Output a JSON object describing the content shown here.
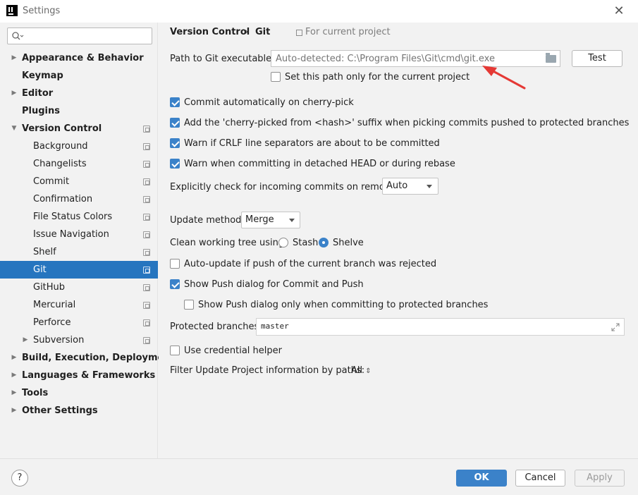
{
  "window": {
    "title": "Settings"
  },
  "search": {
    "placeholder": "",
    "value": ""
  },
  "sidebar": {
    "items": [
      {
        "label": "Appearance & Behavior",
        "bold": true,
        "expandable": true,
        "expanded": false
      },
      {
        "label": "Keymap",
        "bold": true
      },
      {
        "label": "Editor",
        "bold": true,
        "expandable": true,
        "expanded": false
      },
      {
        "label": "Plugins",
        "bold": true
      },
      {
        "label": "Version Control",
        "bold": true,
        "expandable": true,
        "expanded": true
      },
      {
        "label": "Background"
      },
      {
        "label": "Changelists"
      },
      {
        "label": "Commit"
      },
      {
        "label": "Confirmation"
      },
      {
        "label": "File Status Colors"
      },
      {
        "label": "Issue Navigation"
      },
      {
        "label": "Shelf"
      },
      {
        "label": "Git",
        "selected": true
      },
      {
        "label": "GitHub"
      },
      {
        "label": "Mercurial"
      },
      {
        "label": "Perforce"
      },
      {
        "label": "Subversion",
        "expandable": true,
        "expanded": false
      },
      {
        "label": "Build, Execution, Deployment",
        "bold": true,
        "expandable": true,
        "expanded": false
      },
      {
        "label": "Languages & Frameworks",
        "bold": true,
        "expandable": true,
        "expanded": false
      },
      {
        "label": "Tools",
        "bold": true,
        "expandable": true,
        "expanded": false
      },
      {
        "label": "Other Settings",
        "bold": true,
        "expandable": true,
        "expanded": false
      }
    ]
  },
  "header": {
    "crumb1": "Version Control",
    "separator": "›",
    "crumb2": "Git",
    "for_project": "For current project"
  },
  "git_path": {
    "label": "Path to Git executable:",
    "placeholder": "Auto-detected: C:\\Program Files\\Git\\cmd\\git.exe",
    "test_label": "Test",
    "current_only_label": "Set this path only for the current project",
    "current_only_checked": false
  },
  "options": {
    "cherry_pick": {
      "label": "Commit automatically on cherry-pick",
      "checked": true
    },
    "cherry_suffix": {
      "label": "Add the 'cherry-picked from <hash>' suffix when picking commits pushed to protected branches",
      "checked": true
    },
    "crlf": {
      "label": "Warn if CRLF line separators are about to be committed",
      "checked": true
    },
    "detached": {
      "label": "Warn when committing in detached HEAD or during rebase",
      "checked": true
    },
    "incoming_label": "Explicitly check for incoming commits on remotes:",
    "incoming_value": "Auto",
    "update_label": "Update method:",
    "update_value": "Merge",
    "clean_label": "Clean working tree using:",
    "stash_label": "Stash",
    "shelve_label": "Shelve",
    "clean_selected": "Shelve",
    "auto_update": {
      "label": "Auto-update if push of the current branch was rejected",
      "checked": false
    },
    "show_push": {
      "label": "Show Push dialog for Commit and Push",
      "checked": true
    },
    "show_push_protected": {
      "label": "Show Push dialog only when committing to protected branches",
      "checked": false
    },
    "protected_label": "Protected branches:",
    "protected_value": "master",
    "credential": {
      "label": "Use credential helper",
      "checked": false
    },
    "filter_label": "Filter Update Project information by paths:",
    "filter_value": "All",
    "filter_spinner": "⇕"
  },
  "footer": {
    "help": "?",
    "ok": "OK",
    "cancel": "Cancel",
    "apply": "Apply"
  },
  "colors": {
    "accent": "#3b82c9",
    "selection": "#2675bf",
    "annotation_arrow": "#e53935"
  },
  "icons": {
    "app": "intellij-icon",
    "close": "close-icon",
    "search": "search-icon",
    "folder": "folder-icon",
    "expand": "expand-icon",
    "project_scope": "project-scope-icon",
    "copy": "copy-settings-icon"
  }
}
